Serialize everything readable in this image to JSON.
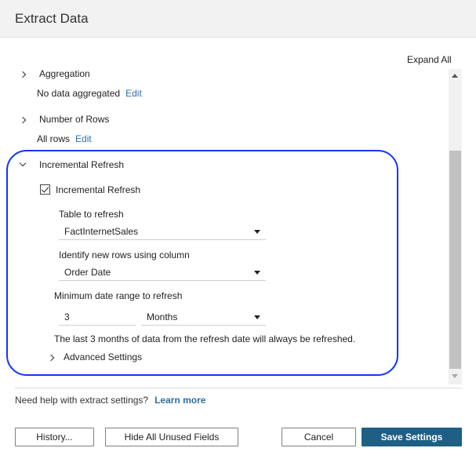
{
  "dialog": {
    "title": "Extract Data"
  },
  "toolbar": {
    "expand_all": "Expand All"
  },
  "sections": {
    "aggregation": {
      "title": "Aggregation",
      "summary": "No data aggregated",
      "edit": "Edit"
    },
    "number_of_rows": {
      "title": "Number of Rows",
      "summary": "All rows",
      "edit": "Edit"
    },
    "incremental": {
      "title": "Incremental Refresh",
      "checkbox_label": "Incremental Refresh",
      "checked": true,
      "table_label": "Table to refresh",
      "table_value": "FactInternetSales",
      "column_label": "Identify new rows using column",
      "column_value": "Order Date",
      "min_range_label": "Minimum date range to refresh",
      "min_range_value": "3",
      "min_range_unit": "Months",
      "note": "The last 3 months of data from the refresh date will always be refreshed.",
      "advanced_label": "Advanced Settings"
    }
  },
  "footer": {
    "help_text": "Need help with extract settings?",
    "learn_more": "Learn more",
    "history_btn": "History...",
    "hide_fields_btn": "Hide All Unused Fields",
    "cancel_btn": "Cancel",
    "save_btn": "Save Settings"
  },
  "colors": {
    "accent": "#1f5f86",
    "link": "#2f6f9f",
    "highlight": "#1434ff"
  }
}
